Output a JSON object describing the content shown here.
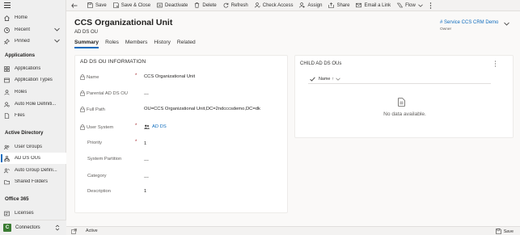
{
  "sidebar": {
    "items": [
      {
        "label": "Home"
      },
      {
        "label": "Recent"
      },
      {
        "label": "Pinned"
      },
      {
        "label": "Applications"
      },
      {
        "label": "Application Types"
      },
      {
        "label": "Roles"
      },
      {
        "label": "Auto Role Definiti..."
      },
      {
        "label": "Files"
      },
      {
        "label": "User Groups"
      },
      {
        "label": "AD DS OUs"
      },
      {
        "label": "Auto Group Defini..."
      },
      {
        "label": "Shared Folders"
      },
      {
        "label": "Licenses"
      }
    ],
    "sections": {
      "applications": "Applications",
      "active_directory": "Active Directory",
      "office365": "Office 365"
    },
    "area": {
      "badge": "C",
      "label": "Connectors"
    }
  },
  "commandbar": {
    "save": "Save",
    "save_close": "Save & Close",
    "deactivate": "Deactivate",
    "delete": "Delete",
    "refresh": "Refresh",
    "check_access": "Check Access",
    "assign": "Assign",
    "share": "Share",
    "email_link": "Email a Link",
    "flow": "Flow"
  },
  "header": {
    "title": "CCS Organizational Unit",
    "subtitle": "AD DS OU",
    "owner_value": "# Service CCS CRM Demo",
    "owner_label": "Owner",
    "tabs": [
      "Summary",
      "Roles",
      "Members",
      "History",
      "Related"
    ]
  },
  "form": {
    "section_title": "AD DS OU INFORMATION",
    "fields": [
      {
        "label": "Name",
        "value": "CCS Organizational Unit"
      },
      {
        "label": "Parental AD DS OU",
        "value": "---"
      },
      {
        "label": "Full Path",
        "value": "OU=CCS Organizational Unit,DC=2ndcccsdemo,DC=dk"
      },
      {
        "label": "User System",
        "value": "AD DS"
      },
      {
        "label": "Priority",
        "value": "1"
      },
      {
        "label": "System Partition",
        "value": "---"
      },
      {
        "label": "Category",
        "value": "---"
      },
      {
        "label": "Description",
        "value": "1"
      }
    ],
    "required_mark": "*"
  },
  "subgrid": {
    "title": "CHILD AD DS OUs",
    "column": "Name",
    "sort_indicator": "↑",
    "empty_text": "No data available."
  },
  "footer": {
    "status": "Active",
    "save": "Save"
  },
  "colors": {
    "accent": "#0f6cbd",
    "required": "#a4262c",
    "area_badge": "#3a7b32"
  }
}
